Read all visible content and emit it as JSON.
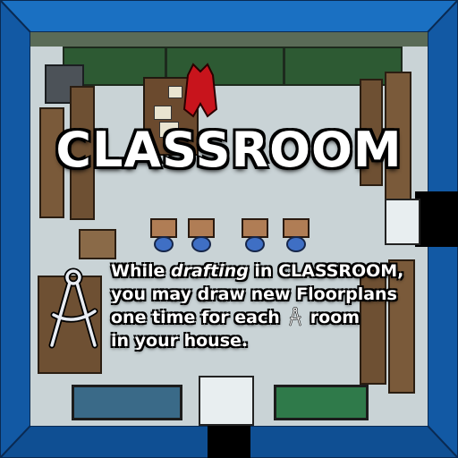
{
  "card": {
    "title": "CLASSROOM",
    "text": {
      "line1_prefix": "While ",
      "line1_em": "drafting",
      "line1_suffix": " in CLASSROOM,",
      "line2": "you may draw new Floorplans",
      "line3_prefix": "one time for each",
      "line3_suffix": "room",
      "line4": "in your house."
    },
    "icons": {
      "large": "drafting-compass-icon",
      "inline": "drafting-compass-icon"
    }
  },
  "colors": {
    "wall": "#1463b0",
    "floor": "#c9d3d6",
    "chalkboard": "#2d5a33",
    "chair": "#3f6fc4",
    "text": "#ffffff",
    "outline": "#000000"
  }
}
